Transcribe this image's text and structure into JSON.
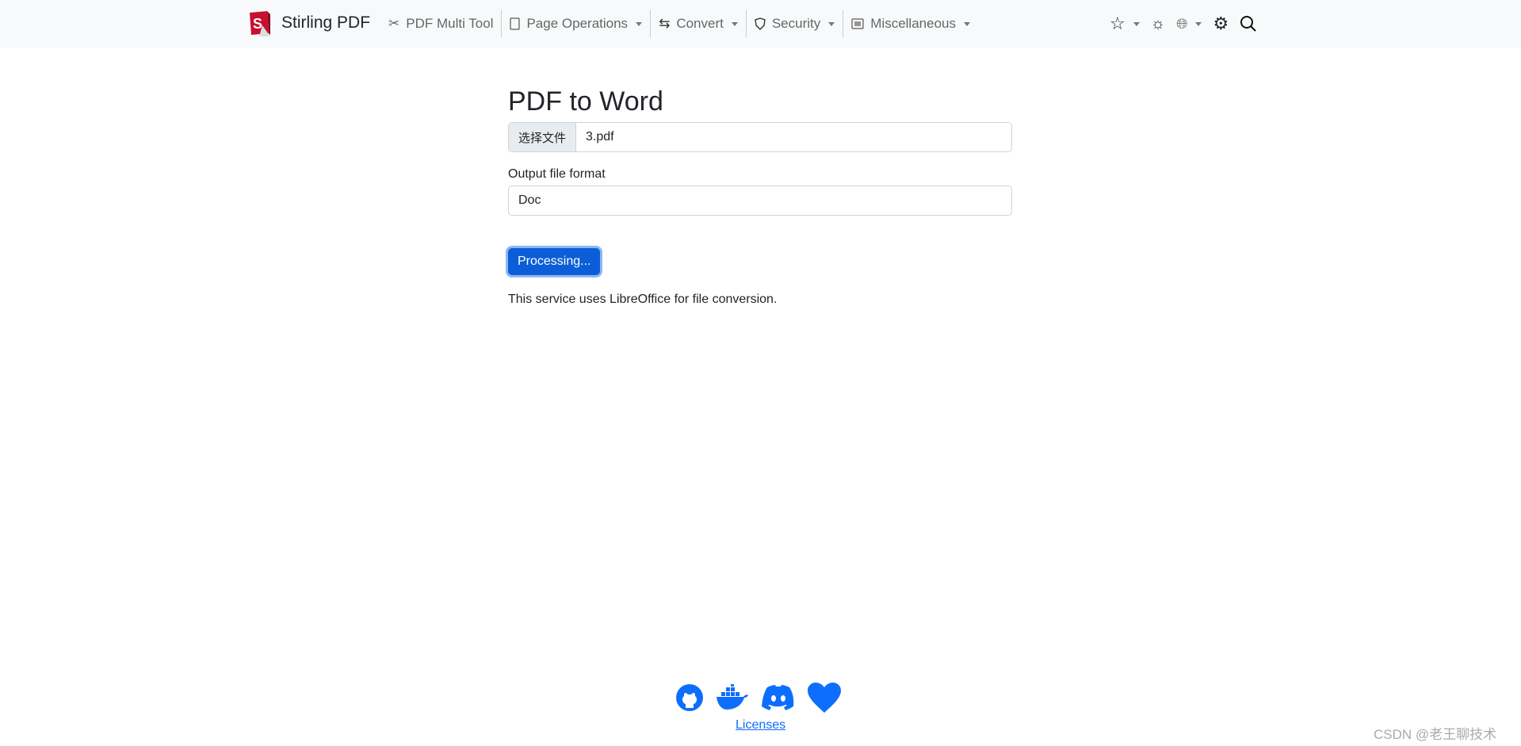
{
  "nav": {
    "brand": "Stirling PDF",
    "items": [
      {
        "label": "PDF Multi Tool",
        "icon": "tools-icon",
        "dropdown": false
      },
      {
        "label": "Page Operations",
        "icon": "file-pdf-icon",
        "dropdown": true
      },
      {
        "label": "Convert",
        "icon": "arrows-exchange-icon",
        "dropdown": true
      },
      {
        "label": "Security",
        "icon": "shield-icon",
        "dropdown": true
      },
      {
        "label": "Miscellaneous",
        "icon": "list-icon",
        "dropdown": true
      }
    ],
    "right_icons": [
      "star-icon",
      "sun-icon",
      "globe-icon",
      "gear-icon",
      "search-icon"
    ]
  },
  "main": {
    "title": "PDF to Word",
    "file_button": "选择文件",
    "file_name": "3.pdf",
    "format_label": "Output file format",
    "format_value": "Doc",
    "submit": "Processing...",
    "note": "This service uses LibreOffice for file conversion."
  },
  "footer": {
    "icons": [
      "github-icon",
      "docker-icon",
      "discord-icon",
      "heart-icon"
    ],
    "licenses": "Licenses"
  },
  "watermark": "CSDN @老王聊技术",
  "colors": {
    "accent": "#0b5ed7",
    "footer_icon": "#0d6efd"
  }
}
